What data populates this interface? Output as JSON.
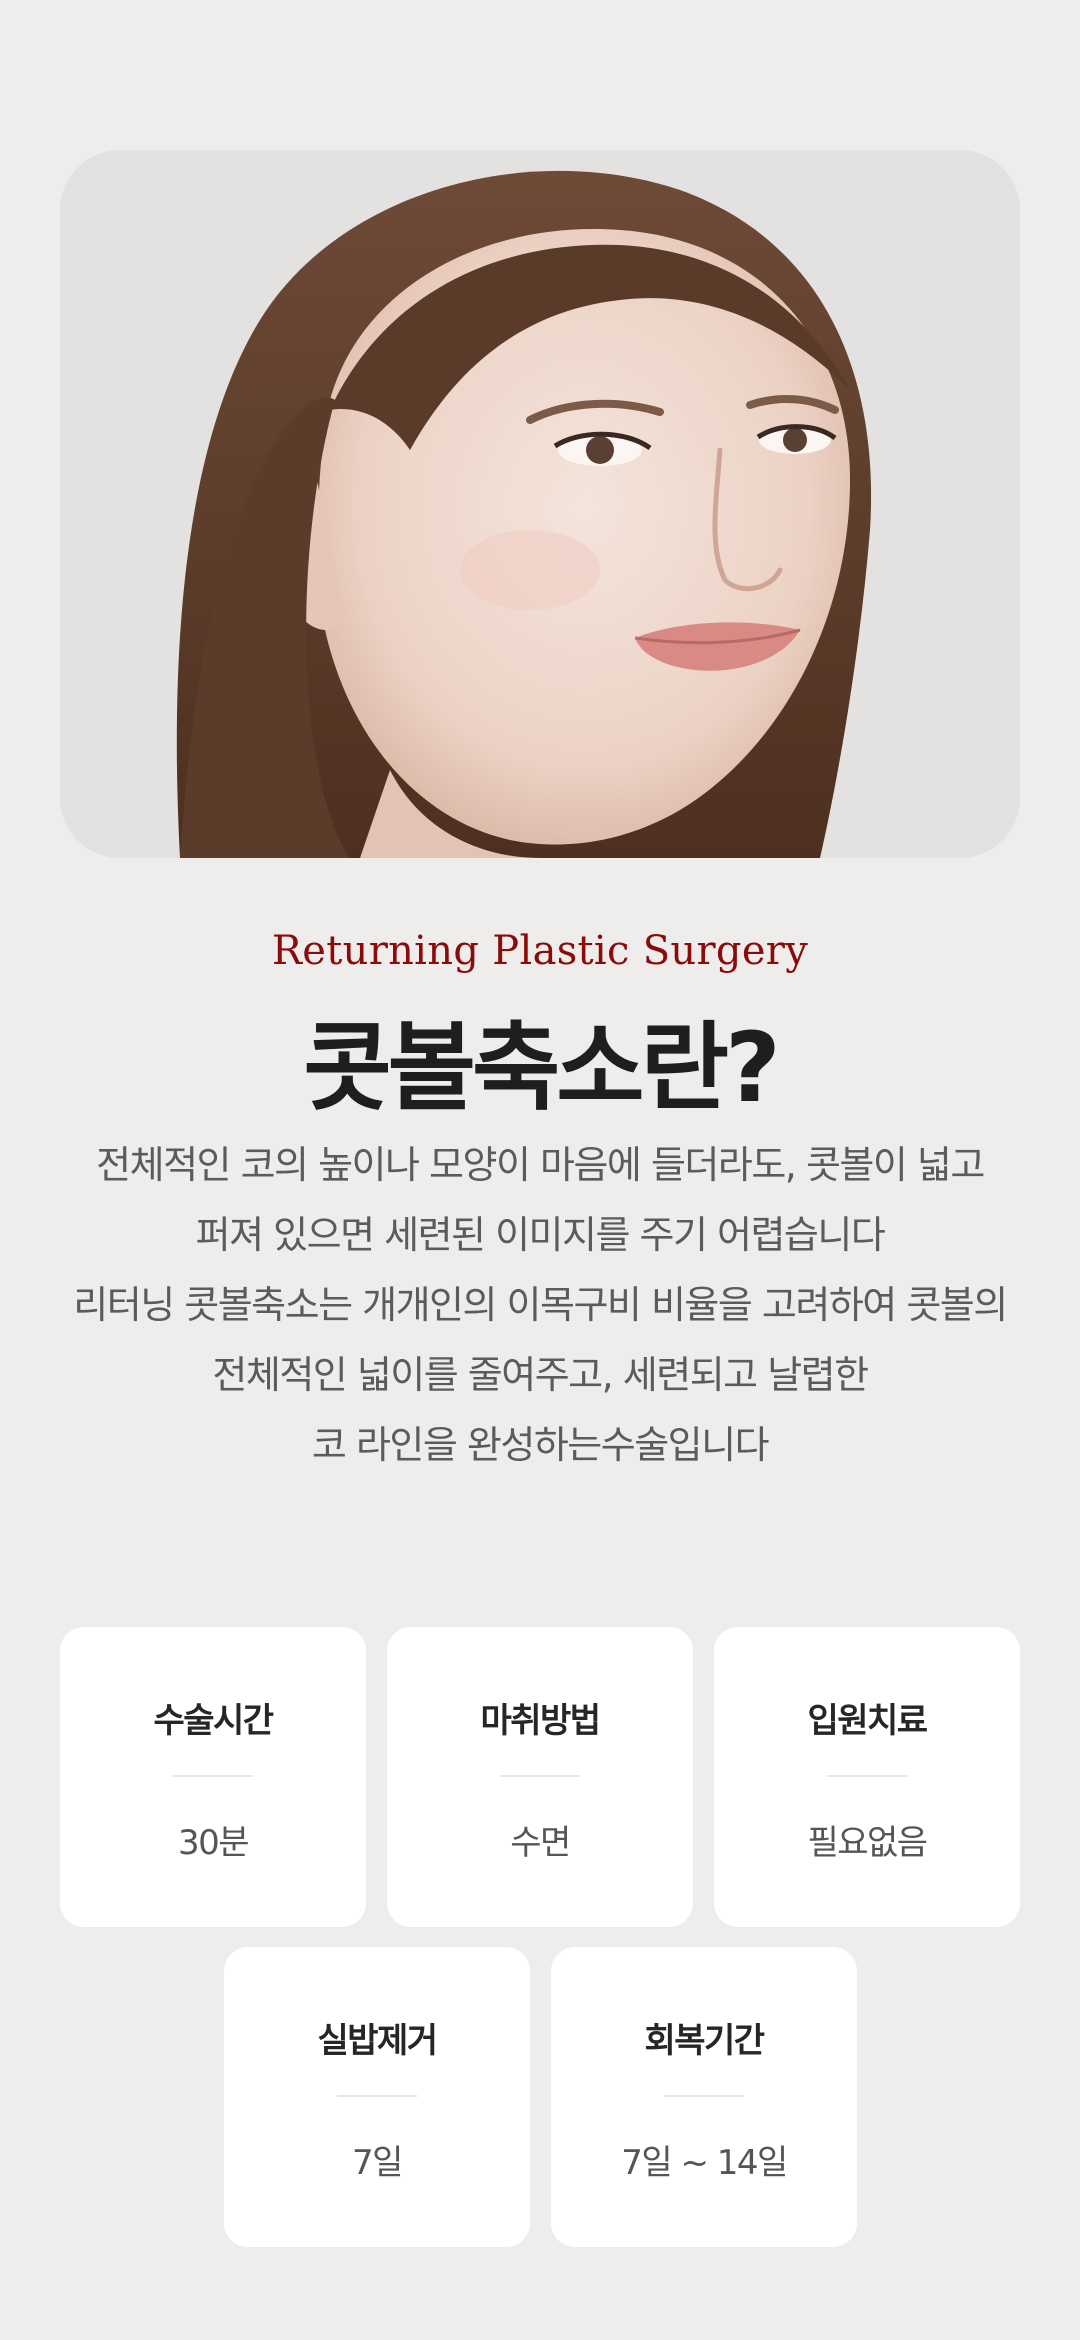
{
  "hero": {
    "image_alt": "close-up portrait of a smiling woman with long brown hair"
  },
  "header": {
    "eyebrow": "Returning Plastic Surgery",
    "title": "콧볼축소란?"
  },
  "description": {
    "lines": [
      "전체적인 코의 높이나 모양이 마음에 들더라도, 콧볼이 넓고",
      "퍼져 있으면 세련된 이미지를 주기 어렵습니다",
      "리터닝 콧볼축소는 개개인의 이목구비 비율을 고려하여 콧볼의",
      "전체적인 넓이를 줄여주고, 세련되고 날렵한",
      "코 라인을 완성하는수술입니다"
    ]
  },
  "info_cards": [
    {
      "label": "수술시간",
      "value": "30분"
    },
    {
      "label": "마취방법",
      "value": "수면"
    },
    {
      "label": "입원치료",
      "value": "필요없음"
    },
    {
      "label": "실밥제거",
      "value": "7일"
    },
    {
      "label": "회복기간",
      "value": "7일 ~ 14일"
    }
  ],
  "colors": {
    "background": "#eeedeb",
    "accent": "#8b0a0a",
    "title": "#1e1e1e",
    "card": "#ffffff"
  }
}
